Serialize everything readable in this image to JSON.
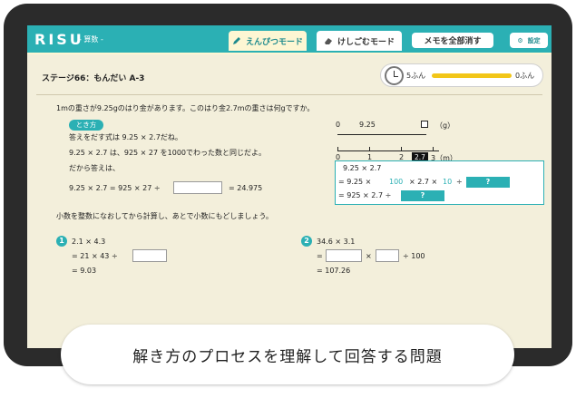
{
  "header": {
    "logo": "RISU",
    "subject": "- 算数 -",
    "tabs": {
      "pencil": "えんぴつモード",
      "eraser": "けしごむモード",
      "memo": "メモを全部消す",
      "settings": "設定"
    },
    "tab_icons": {
      "pencil": "pencil-icon",
      "eraser": "eraser-icon",
      "settings": "gear-icon"
    }
  },
  "stage": {
    "title": "ステージ66：もんだい A-3",
    "timer_start": "5ふん",
    "timer_end": "0ふん",
    "timer_remaining_fraction": 1.0
  },
  "problem": {
    "question": "1mの重さが9.25gのはり金があります。このはり金2.7mの重さは何gですか。",
    "toki_label": "とき方",
    "lines": [
      "答えをだす式は 9.25 × 2.7だね。",
      "9.25 × 2.7 は、925 × 27 を1000でわった数と同じだよ。",
      "だから答えは、"
    ],
    "equation_left": "9.25 × 2.7 = 925 × 27 ÷",
    "equation_right": "= 24.975",
    "hint": "小数を整数になおしてから計算し、あとで小数にもどしましょう。"
  },
  "number_line": {
    "top_labels": [
      "0",
      "9.25",
      "（g）"
    ],
    "bottom_labels": [
      "0",
      "1",
      "2",
      "3（m）"
    ],
    "highlight": "2.7"
  },
  "workbox": {
    "line1": "9.25 × 2.7",
    "line2_prefix": "= 9.25 ×",
    "line2_a": "100",
    "line2_mid": "× 2.7 ×",
    "line2_b": "10",
    "line2_suffix": "÷",
    "line3": "= 925 × 2.7 ÷",
    "unknown": "?"
  },
  "exercises": [
    {
      "num": "1",
      "line1": "2.1 × 4.3",
      "line2_pre": "= 21 × 43 ÷",
      "line3": "= 9.03"
    },
    {
      "num": "2",
      "line1": "34.6 × 3.1",
      "line2_pre": "=",
      "line2_mid": "×",
      "line2_post": "÷ 100",
      "line3": "= 107.26"
    }
  ],
  "caption": "解き方のプロセスを理解して回答する問題"
}
